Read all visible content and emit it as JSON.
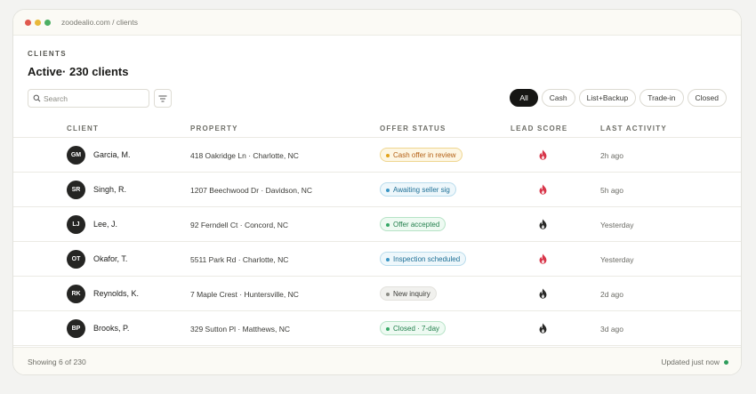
{
  "window": {
    "url": "zoodealio.com / clients"
  },
  "header": {
    "eyebrow": "CLIENTS",
    "title": "Active· 230 clients"
  },
  "search": {
    "placeholder": "Search",
    "value": ""
  },
  "filters": {
    "chips": [
      {
        "label": "All",
        "active": true
      },
      {
        "label": "Cash",
        "active": false
      },
      {
        "label": "List+Backup",
        "active": false
      },
      {
        "label": "Trade-in",
        "active": false
      },
      {
        "label": "Closed",
        "active": false
      }
    ]
  },
  "table": {
    "columns": [
      "CLIENT",
      "PROPERTY",
      "OFFER STATUS",
      "LEAD SCORE",
      "LAST ACTIVITY"
    ],
    "rows": [
      {
        "initials": "GM",
        "name": "Garcia, M.",
        "property": "418 Oakridge Ln · Charlotte, NC",
        "status": "Cash offer in review",
        "status_type": "review",
        "lead": "hot",
        "activity": "2h ago"
      },
      {
        "initials": "SR",
        "name": "Singh, R.",
        "property": "1207 Beechwood Dr · Davidson, NC",
        "status": "Awaiting seller sig",
        "status_type": "info",
        "lead": "hot",
        "activity": "5h ago"
      },
      {
        "initials": "LJ",
        "name": "Lee, J.",
        "property": "92 Ferndell Ct · Concord, NC",
        "status": "Offer accepted",
        "status_type": "success",
        "lead": "warm",
        "activity": "Yesterday"
      },
      {
        "initials": "OT",
        "name": "Okafor, T.",
        "property": "5511 Park Rd · Charlotte, NC",
        "status": "Inspection scheduled",
        "status_type": "info",
        "lead": "hot",
        "activity": "Yesterday"
      },
      {
        "initials": "RK",
        "name": "Reynolds, K.",
        "property": "7 Maple Crest · Huntersville, NC",
        "status": "New inquiry",
        "status_type": "neutral",
        "lead": "warm",
        "activity": "2d ago"
      },
      {
        "initials": "BP",
        "name": "Brooks, P.",
        "property": "329 Sutton Pl · Matthews, NC",
        "status": "Closed · 7-day",
        "status_type": "success",
        "lead": "warm",
        "activity": "3d ago"
      }
    ]
  },
  "footer": {
    "showing": "Showing 6 of 230",
    "updated": "Updated just now"
  },
  "colors": {
    "hot": "#d8364a",
    "warm": "#2a2a28",
    "live": "#2e9d5c",
    "status": {
      "review": {
        "bg": "#fdf6e3",
        "border": "#efd690",
        "text": "#b35e12",
        "dot": "#e2a31b"
      },
      "info": {
        "bg": "#eef7fb",
        "border": "#b9dcec",
        "text": "#1d6f96",
        "dot": "#3a95c4"
      },
      "success": {
        "bg": "#eefaf2",
        "border": "#b6e3c6",
        "text": "#23804d",
        "dot": "#37a866"
      },
      "neutral": {
        "bg": "#f1f1ee",
        "border": "#e2e1dc",
        "text": "#3b3b37",
        "dot": "#8d8d86"
      }
    }
  }
}
